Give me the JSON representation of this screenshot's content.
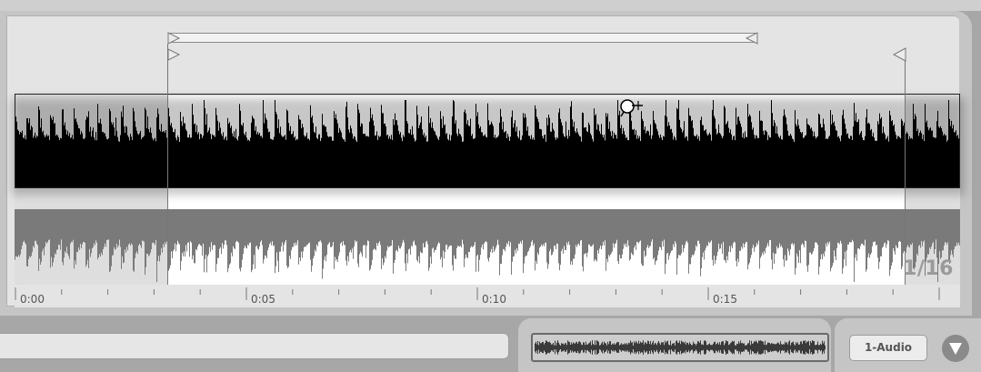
{
  "clip": {
    "waveform_colors": {
      "upper_channel": "#000000",
      "lower_channel": "#7a7a7a",
      "active_background": "#ffffff",
      "inactive_background": "#dedede"
    },
    "grid_label": "1/16",
    "timeline_labels": [
      "0:00",
      "0:05",
      "0:10",
      "0:15"
    ],
    "icons": {
      "loop_start": "loop-start-marker-icon",
      "loop_end": "loop-end-marker-icon",
      "start_marker": "start-marker-icon",
      "end_marker": "end-marker-icon",
      "cursor": "zoom-cursor-icon"
    }
  },
  "bottom": {
    "track_name": "1-Audio",
    "name_field_value": "",
    "dropdown_icon": "triangle-down-icon"
  }
}
